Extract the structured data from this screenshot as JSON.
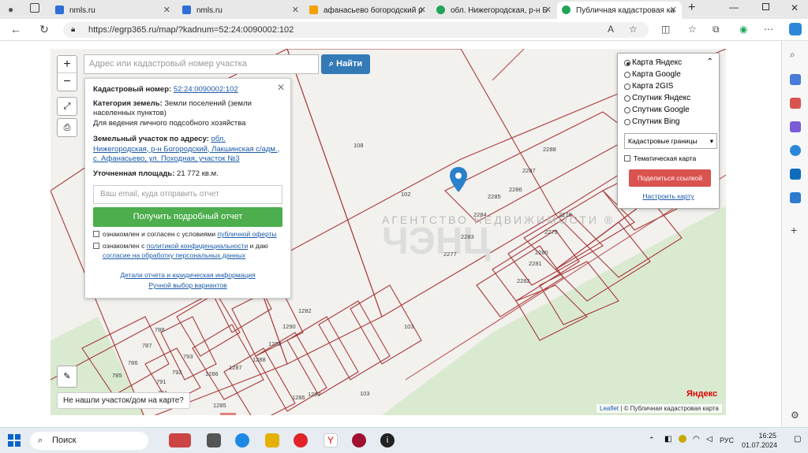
{
  "browser": {
    "tabs": [
      {
        "label": "nmls.ru",
        "color": "#2f6fd6"
      },
      {
        "label": "nmls.ru",
        "color": "#2f6fd6"
      },
      {
        "label": "афанасьево богородский р",
        "color": "#f4a100"
      },
      {
        "label": "обл. Нижегородская, р-н Б",
        "color": "#20a35a"
      },
      {
        "label": "Публичная кадастровая ка",
        "color": "#20a35a"
      }
    ],
    "url": "https://egrp365.ru/map/?kadnum=52:24:0090002:102",
    "read_aloud": "A"
  },
  "search": {
    "placeholder": "Адрес или кадастровый номер участка",
    "button": "Найти"
  },
  "zoom": {
    "in": "+",
    "out": "−"
  },
  "info": {
    "cad_label": "Кадастровый номер:",
    "cad_value": "52:24:0090002:102",
    "cat_label": "Категория земель:",
    "cat_value": "Земли поселений (земли населенных пунктов)",
    "use": "Для ведения личного подсобного хозяйства",
    "addr_label": "Земельный участок по адресу:",
    "addr_value": "обл. Нижегородская, р-н Богородский, Лакшинская с/адм., с. Афанасьево, ул. Походная, участок №3",
    "area_label": "Уточненная площадь:",
    "area_value": "21 772 кв.м.",
    "email_placeholder": "Ваш email, куда отправить отчет",
    "report_button": "Получить подробный отчет",
    "chk1_text": "ознакомлен и согласен с условиями",
    "chk1_link": "публичной оферты",
    "chk2_text": "ознакомлен с",
    "chk2_link": "политикой конфиденциальности",
    "chk2_and": "и даю",
    "chk2_link2": "согласие на обработку персональных данных",
    "details_link": "Детали отчета и юридическая информация",
    "manual_link": "Ручной выбор вариантов"
  },
  "layers": {
    "options": [
      "Карта Яндекс",
      "Карта Google",
      "Карта 2GIS",
      "Спутник Яндекс",
      "Спутник Google",
      "Спутник Bing"
    ],
    "selected_index": 0,
    "dropdown": "Кадастровые границы",
    "thematic": "Тематическая карта",
    "share_button": "Поделиться ссылкой",
    "restore_link": "Настроить карту"
  },
  "map": {
    "labels": [
      {
        "t": "107"
      },
      {
        "t": "108"
      },
      {
        "t": "102"
      },
      {
        "t": "103"
      },
      {
        "t": "103"
      },
      {
        "t": "110"
      },
      {
        "t": "2288"
      },
      {
        "t": "2287"
      },
      {
        "t": "2286"
      },
      {
        "t": "2285"
      },
      {
        "t": "2284"
      },
      {
        "t": "2283"
      },
      {
        "t": "2277"
      },
      {
        "t": "2278"
      },
      {
        "t": "2279"
      },
      {
        "t": "2280"
      },
      {
        "t": "2281"
      },
      {
        "t": "2282"
      },
      {
        "t": "1282"
      },
      {
        "t": "1290"
      },
      {
        "t": "1289"
      },
      {
        "t": "1288"
      },
      {
        "t": "1287"
      },
      {
        "t": "1286"
      },
      {
        "t": "1285"
      },
      {
        "t": "788"
      },
      {
        "t": "787"
      },
      {
        "t": "786"
      },
      {
        "t": "785"
      },
      {
        "t": "793"
      },
      {
        "t": "792"
      },
      {
        "t": "791"
      },
      {
        "t": "790"
      },
      {
        "t": "791"
      },
      {
        "t": "1287"
      },
      {
        "t": "1286"
      }
    ],
    "watermark": "АГЕНТСТВО НЕДВИЖИМОСТИ ®",
    "not_found": "Не нашли участок/дом на карте?",
    "attribution_leaflet": "Leaflet",
    "attribution_text": "| © Публичная кадастровая карта",
    "yandex": "Яндекс"
  },
  "taskbar": {
    "search": "Поиск",
    "lang": "РУС",
    "time": "16:25",
    "date": "01.07.2024"
  }
}
